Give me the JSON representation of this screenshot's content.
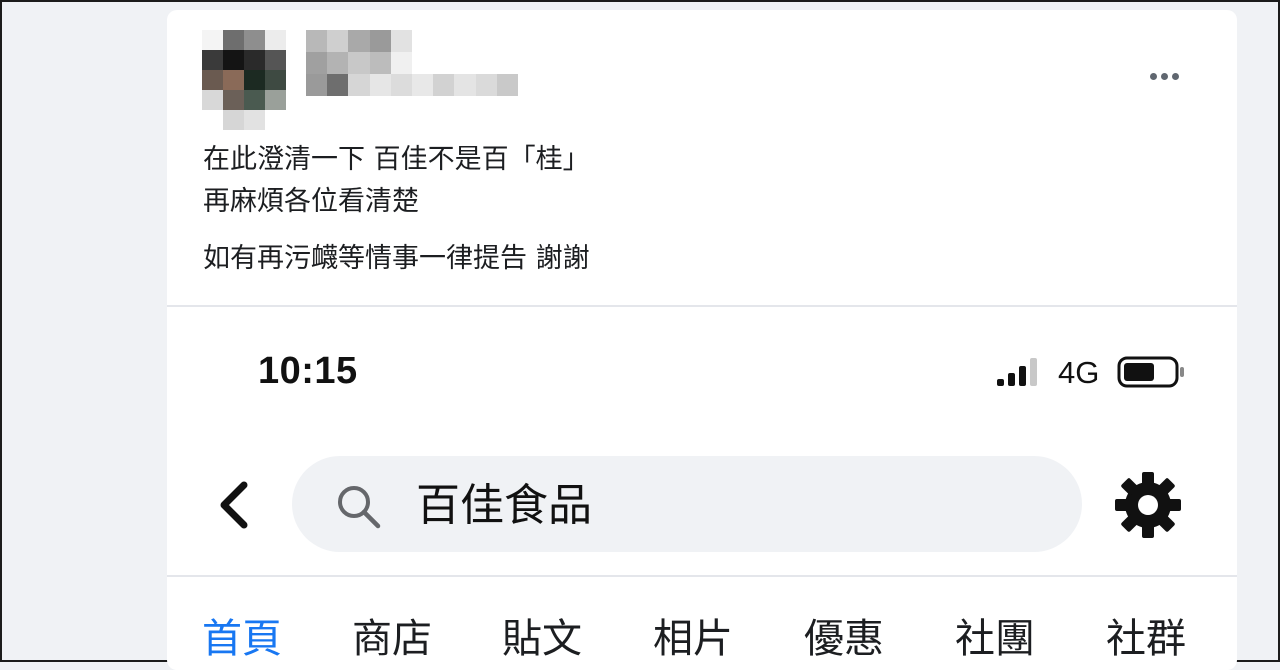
{
  "post": {
    "lines": [
      "在此澄清一下 百佳不是百「桂」",
      "再麻煩各位看清楚",
      "如有再污衊等情事一律提告 謝謝"
    ],
    "more_icon": "more-horizontal-icon"
  },
  "phone": {
    "time": "10:15",
    "network": "4G",
    "icons": {
      "signal": "signal-bars-icon",
      "battery": "battery-icon",
      "back": "back-chevron-icon",
      "search": "search-icon",
      "settings": "gear-icon"
    },
    "search": {
      "value": "百佳食品"
    },
    "tabs": [
      {
        "label": "首頁",
        "active": true
      },
      {
        "label": "商店",
        "active": false
      },
      {
        "label": "貼文",
        "active": false
      },
      {
        "label": "相片",
        "active": false
      },
      {
        "label": "優惠",
        "active": false
      },
      {
        "label": "社團",
        "active": false
      },
      {
        "label": "社群",
        "active": false
      }
    ]
  },
  "colors": {
    "accent": "#1877f2",
    "text": "#1c1e21",
    "page_bg": "#f0f2f5",
    "card_bg": "#ffffff"
  }
}
